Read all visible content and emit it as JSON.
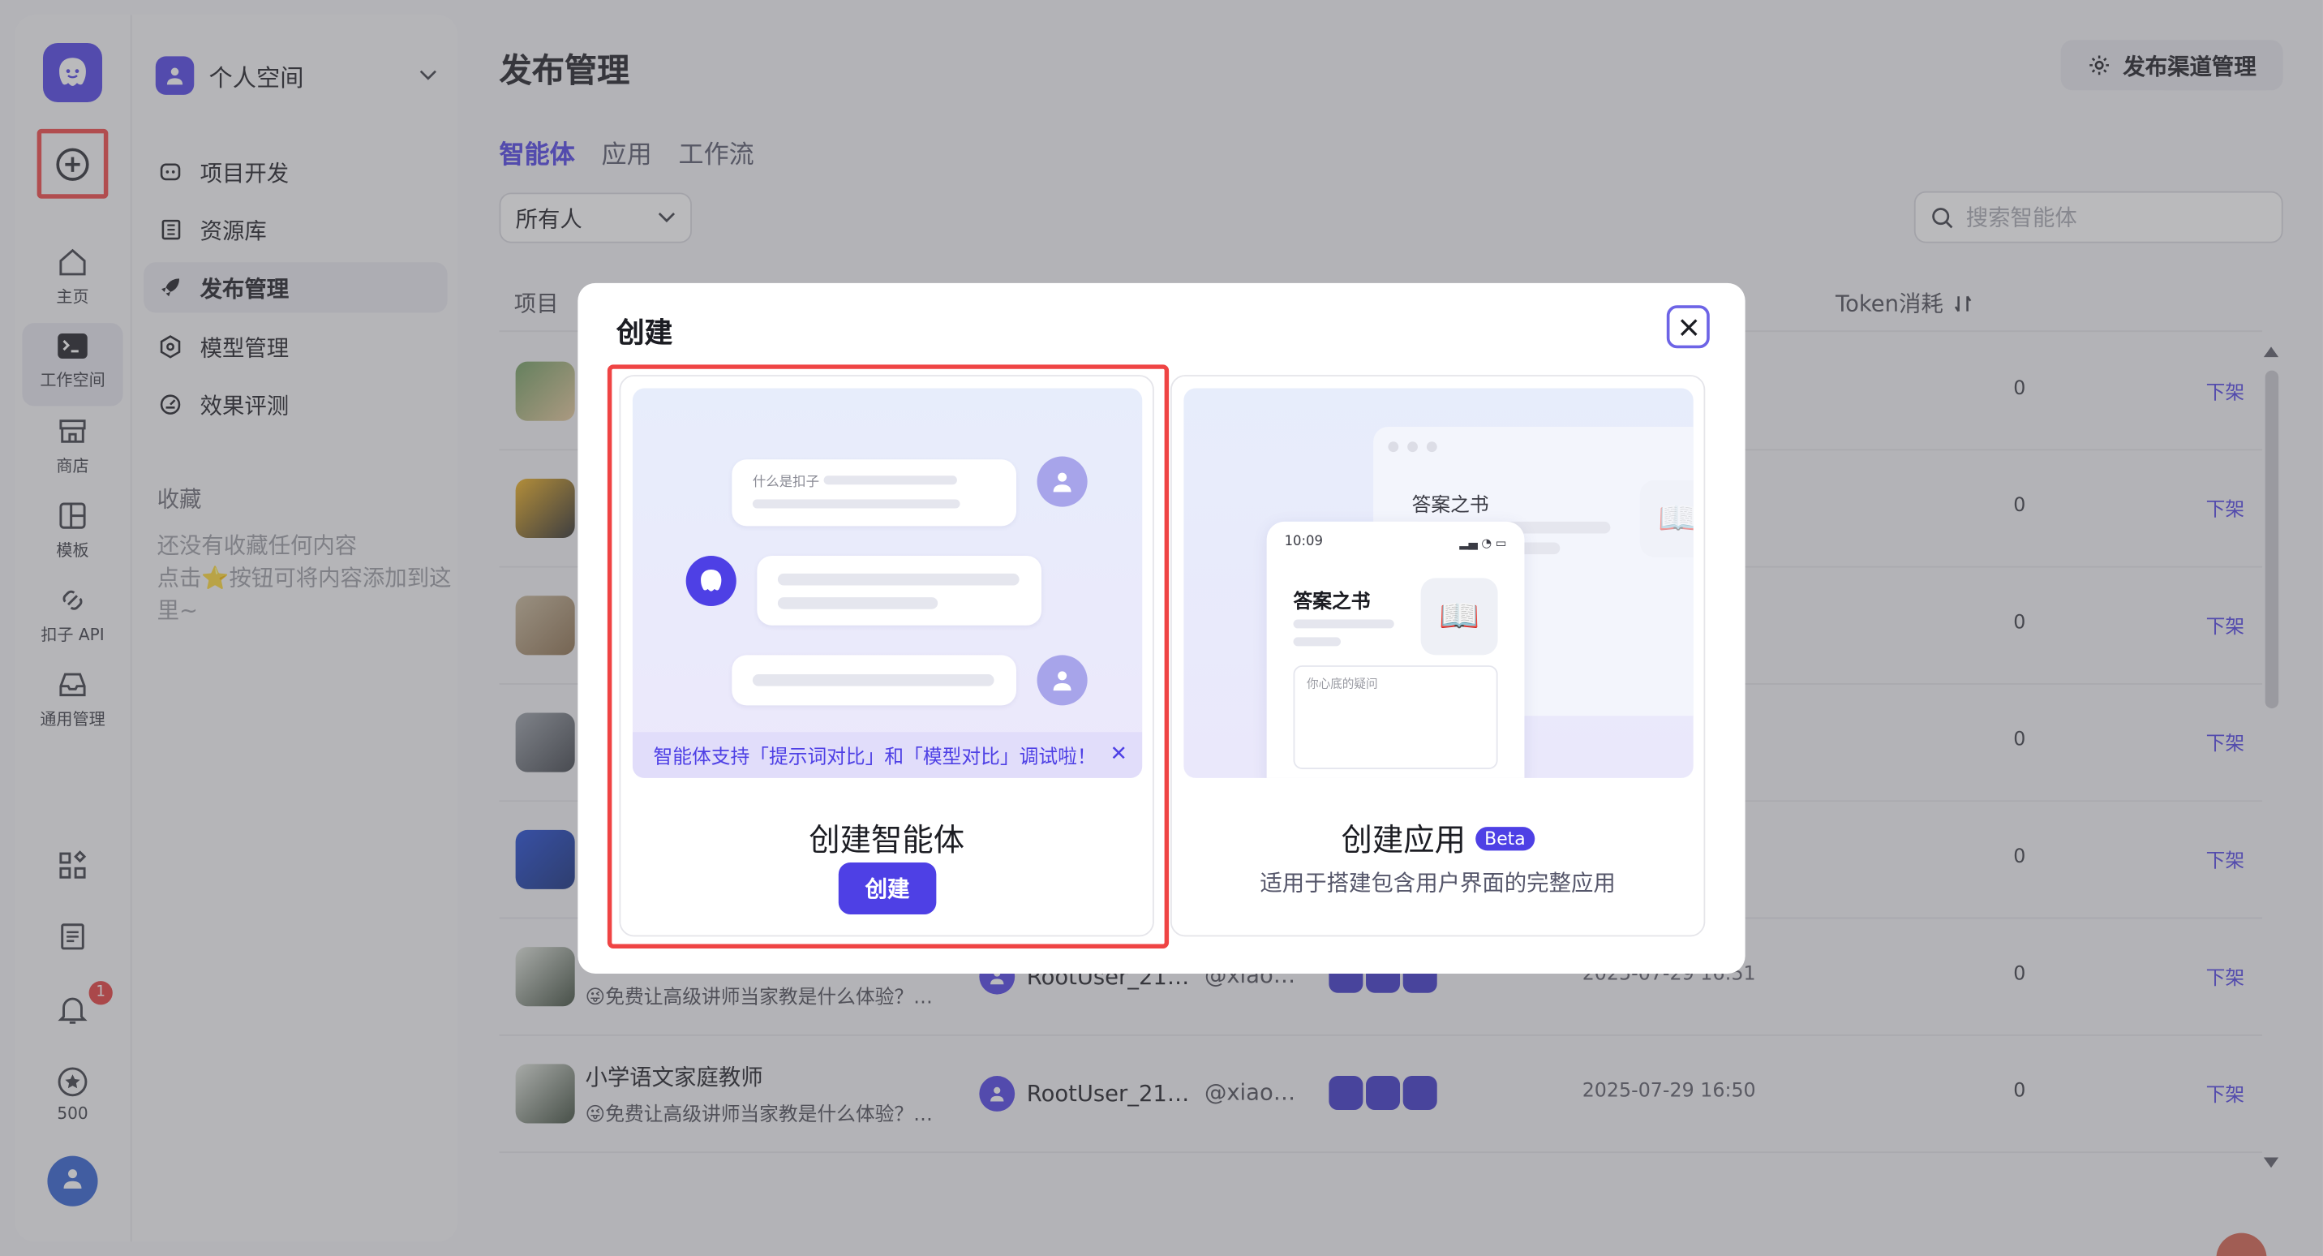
{
  "rail": {
    "items": [
      {
        "label": "主页",
        "icon": "home-icon"
      },
      {
        "label": "工作空间",
        "icon": "terminal-icon"
      },
      {
        "label": "商店",
        "icon": "store-icon"
      },
      {
        "label": "模板",
        "icon": "template-icon"
      },
      {
        "label": "扣子 API",
        "icon": "api-icon"
      },
      {
        "label": "通用管理",
        "icon": "inbox-icon"
      }
    ],
    "notification_badge": "1",
    "points": "500"
  },
  "sidebar": {
    "space_name": "个人空间",
    "nav": [
      {
        "label": "项目开发",
        "icon": "project-icon"
      },
      {
        "label": "资源库",
        "icon": "library-icon"
      },
      {
        "label": "发布管理",
        "icon": "rocket-icon"
      },
      {
        "label": "模型管理",
        "icon": "model-icon"
      },
      {
        "label": "效果评测",
        "icon": "evaluate-icon"
      }
    ],
    "favorites_title": "收藏",
    "favorites_empty": "还没有收藏任何内容",
    "favorites_hint": "点击⭐按钮可将内容添加到这里~"
  },
  "main": {
    "title": "发布管理",
    "channel_button": "发布渠道管理",
    "tabs": [
      {
        "label": "智能体"
      },
      {
        "label": "应用"
      },
      {
        "label": "工作流"
      }
    ],
    "filter_value": "所有人",
    "search_placeholder": "搜索智能体",
    "columns": {
      "project": "项目",
      "token": "Token消耗"
    },
    "rows": [
      {
        "name": "",
        "desc": "",
        "user": "",
        "handle": "",
        "date": "",
        "tokens": "0",
        "action": "下架"
      },
      {
        "name": "",
        "desc": "",
        "user": "",
        "handle": "",
        "date": "",
        "tokens": "0",
        "action": "下架"
      },
      {
        "name": "",
        "desc": "",
        "user": "",
        "handle": "",
        "date": "",
        "tokens": "0",
        "action": "下架"
      },
      {
        "name": "",
        "desc": "",
        "user": "",
        "handle": "",
        "date": "",
        "tokens": "0",
        "action": "下架"
      },
      {
        "name": "",
        "desc": "",
        "user": "",
        "handle": "",
        "date": "",
        "tokens": "0",
        "action": "下架"
      },
      {
        "name": "",
        "desc": "😜免费让高级讲师当家教是什么体验？…",
        "user": "RootUser_21…",
        "handle": "@xiao…",
        "date": "2025-07-29 16:51",
        "tokens": "0",
        "action": "下架"
      },
      {
        "name": "小学语文家庭教师",
        "desc": "😜免费让高级讲师当家教是什么体验？…",
        "user": "RootUser_21…",
        "handle": "@xiao…",
        "date": "2025-07-29 16:50",
        "tokens": "0",
        "action": "下架"
      }
    ]
  },
  "modal": {
    "title": "创建",
    "agent_card": {
      "preview_question": "什么是扣子",
      "banner": "智能体支持「提示词对比」和「模型对比」调试啦！",
      "title": "创建智能体",
      "button": "创建"
    },
    "app_card": {
      "preview_app_name": "答案之书",
      "preview_time": "10:09",
      "preview_input": "你心底的疑问",
      "title": "创建应用",
      "badge": "Beta",
      "subtitle": "适用于搭建包含用户界面的完整应用"
    }
  },
  "colors": {
    "brand": "#4e40e5",
    "highlight": "#ef4444"
  }
}
